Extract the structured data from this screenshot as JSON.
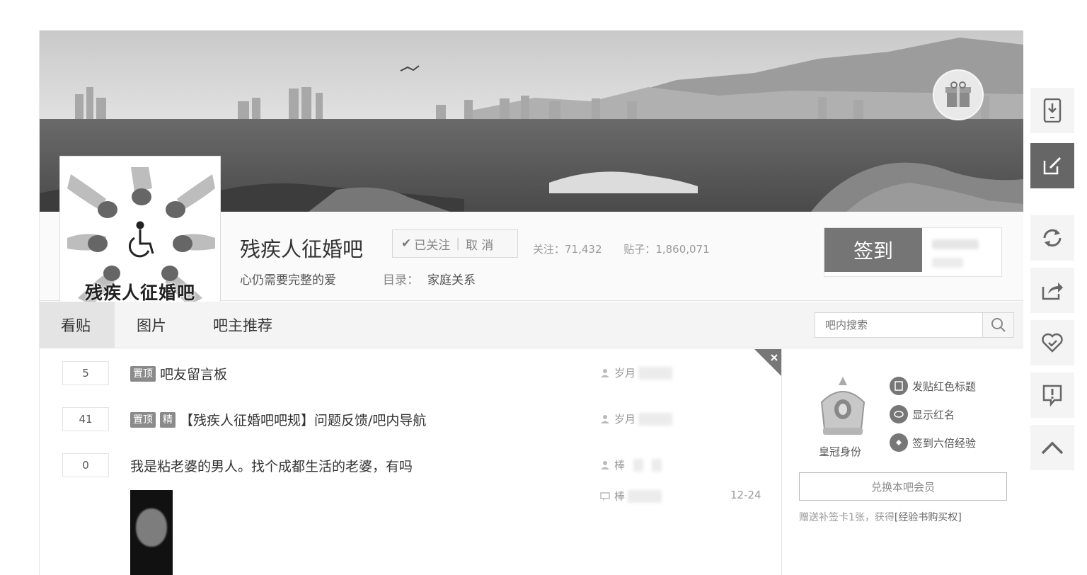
{
  "forum": {
    "name": "残疾人征婚吧",
    "avatar_text": "残疾人征婚吧",
    "slogan": "心仍需要完整的爱",
    "catalog_label": "目录：",
    "catalog_value": "家庭关系",
    "follow": {
      "followed_label": "已关注",
      "cancel_label": "取 消"
    },
    "stats": {
      "follow_label": "关注：",
      "follow_count": "71,432",
      "posts_label": "贴子：",
      "posts_count": "1,860,071"
    },
    "sign_label": "签到"
  },
  "tabs": [
    {
      "label": "看贴"
    },
    {
      "label": "图片"
    },
    {
      "label": "吧主推荐"
    }
  ],
  "search": {
    "placeholder": "吧内搜索"
  },
  "threads": [
    {
      "replies": "5",
      "badges": [
        "置顶"
      ],
      "title": "吧友留言板",
      "author": "岁月"
    },
    {
      "replies": "41",
      "badges": [
        "置顶",
        "精"
      ],
      "title": "【残疾人征婚吧吧规】问题反馈/吧内导航",
      "author": "岁月"
    },
    {
      "replies": "0",
      "badges": [],
      "title": "我是粘老婆的男人。找个成都生活的老婆，有吗",
      "author": "棒",
      "last_reply": "棒",
      "date": "12-24"
    }
  ],
  "aside": {
    "crown_label": "皇冠身份",
    "perks": [
      "发贴红色标题",
      "显示红名",
      "签到六倍经验"
    ],
    "vip_button": "兑换本吧会员",
    "note_prefix": "赠送补签卡1张，获得",
    "note_link": "[经验书购买权]"
  },
  "icons": {
    "toolbar": [
      "phone-download-icon",
      "edit-icon",
      "refresh-icon",
      "share-icon",
      "heart-icon",
      "report-icon",
      "back-to-top-icon"
    ],
    "gift": "gift-icon",
    "search": "search-icon"
  }
}
